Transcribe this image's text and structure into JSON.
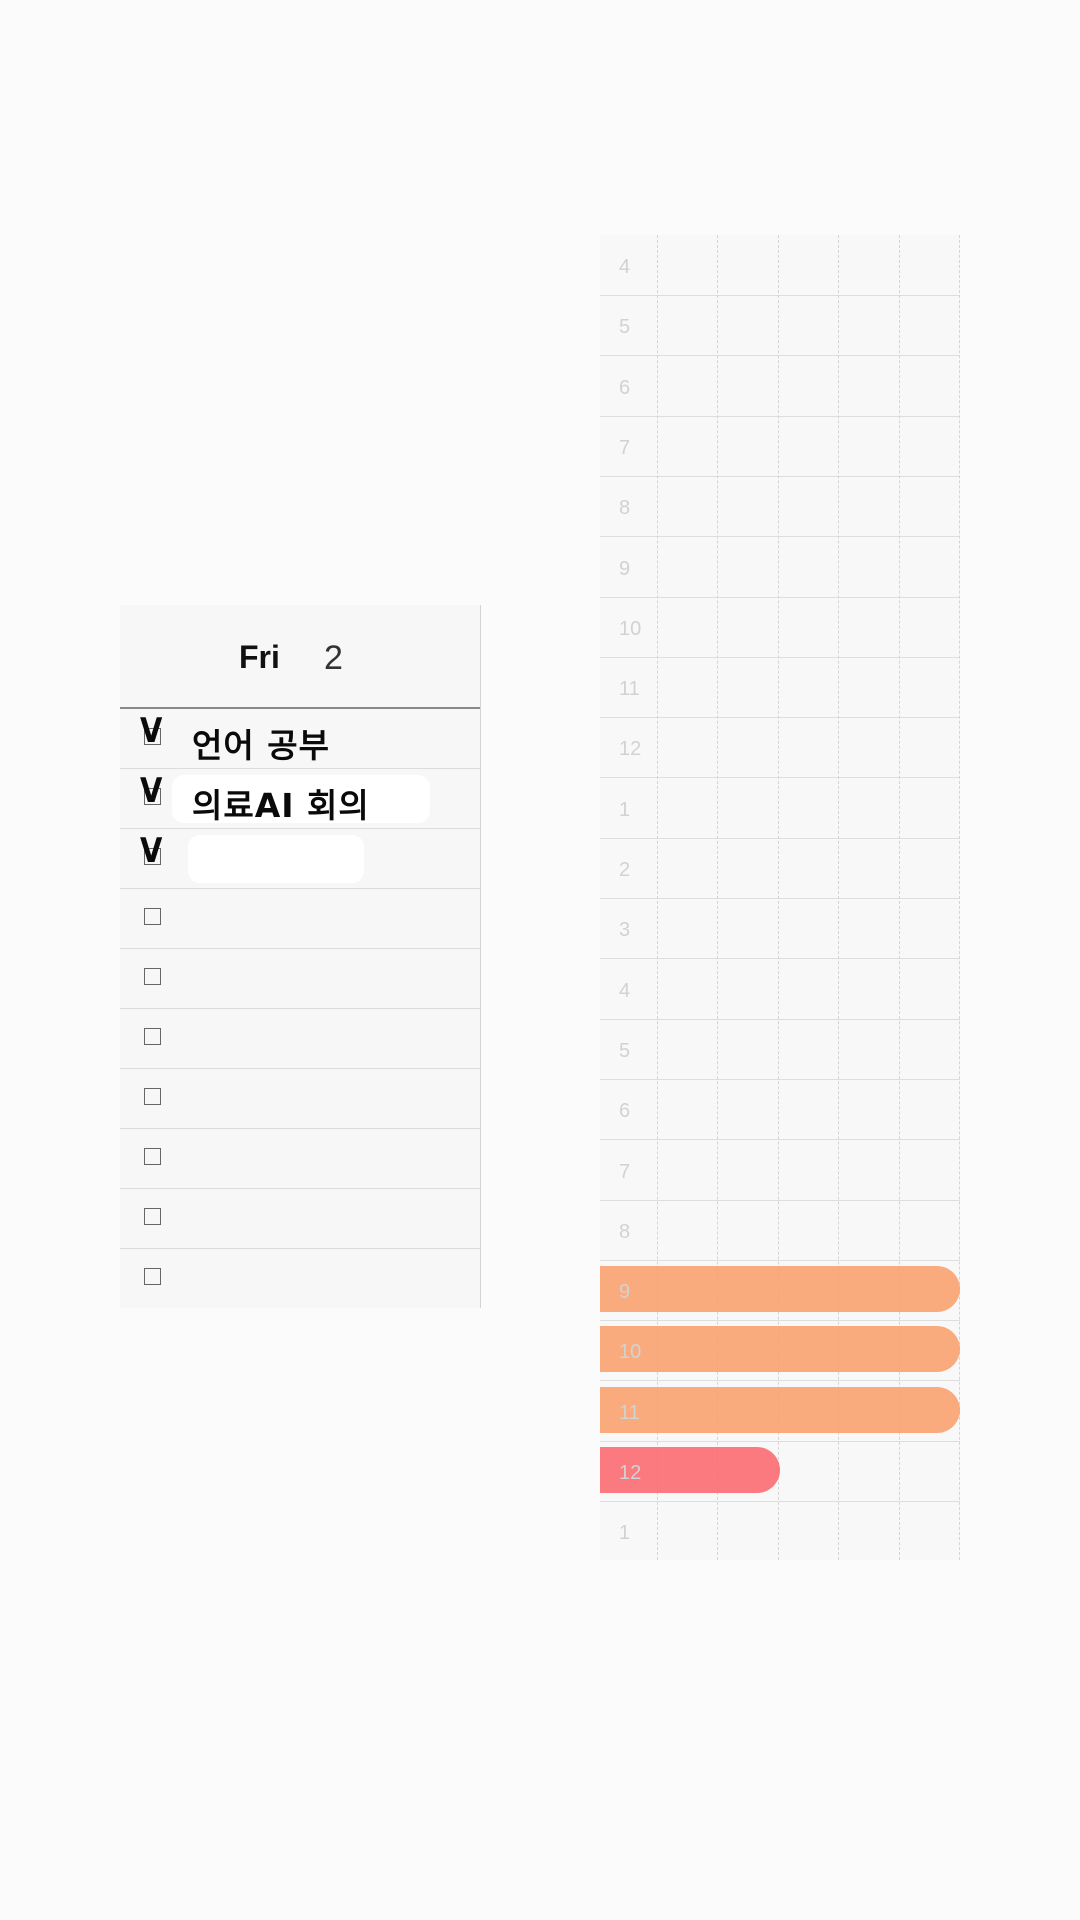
{
  "day": {
    "name": "Fri",
    "number": "2"
  },
  "todos": [
    {
      "text": "언어 공부",
      "checked": true
    },
    {
      "text": "의료AI 회의",
      "checked": true
    },
    {
      "text": "",
      "checked": true
    },
    {
      "text": "",
      "checked": false
    },
    {
      "text": "",
      "checked": false
    },
    {
      "text": "",
      "checked": false
    },
    {
      "text": "",
      "checked": false
    },
    {
      "text": "",
      "checked": false
    },
    {
      "text": "",
      "checked": false
    },
    {
      "text": "",
      "checked": false
    }
  ],
  "check_mark_glyph": "V",
  "timetable": {
    "hours": [
      "4",
      "5",
      "6",
      "7",
      "8",
      "9",
      "10",
      "11",
      "12",
      "1",
      "2",
      "3",
      "4",
      "5",
      "6",
      "7",
      "8",
      "9",
      "10",
      "11",
      "12",
      "1"
    ],
    "events": [
      {
        "hour": "9",
        "color": "#f9a26f",
        "fill": 1.0
      },
      {
        "hour": "10",
        "color": "#f9a26f",
        "fill": 1.0
      },
      {
        "hour": "11",
        "color": "#f9a26f",
        "fill": 1.0
      },
      {
        "hour": "12",
        "color": "#fb6c72",
        "fill": 0.5
      }
    ]
  }
}
